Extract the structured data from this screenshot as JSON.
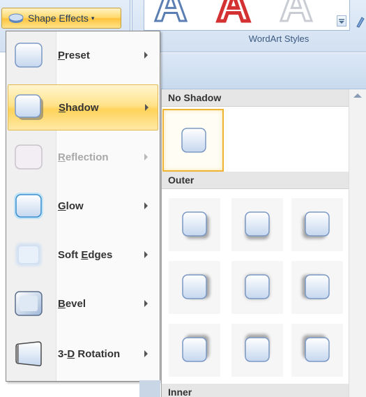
{
  "ribbon": {
    "shape_effects_label": "Shape Effects",
    "wordart_styles_label": "WordArt Styles",
    "wordart_letter": "A",
    "wordart_colors": [
      "#5b7fb3",
      "#d43232",
      "#c9cdd3"
    ]
  },
  "menu": {
    "items": [
      {
        "label": "Preset",
        "accel": "P",
        "rest": "reset",
        "icon": "preset-icon",
        "highlighted": false,
        "disabled": false
      },
      {
        "label": "Shadow",
        "accel": "S",
        "rest": "hadow",
        "icon": "shadow-icon",
        "highlighted": true,
        "disabled": false
      },
      {
        "label": "Reflection",
        "accel": "R",
        "rest": "eflection",
        "icon": "reflection-icon",
        "highlighted": false,
        "disabled": true
      },
      {
        "label": "Glow",
        "accel": "G",
        "rest": "low",
        "icon": "glow-icon",
        "highlighted": false,
        "disabled": false
      },
      {
        "label": "Soft Edges",
        "pre": "Soft ",
        "accel": "E",
        "rest": "dges",
        "icon": "soft-edges-icon",
        "highlighted": false,
        "disabled": false
      },
      {
        "label": "Bevel",
        "accel": "B",
        "rest": "evel",
        "icon": "bevel-icon",
        "highlighted": false,
        "disabled": false
      },
      {
        "label": "3-D Rotation",
        "pre": "3-",
        "accel": "D",
        "rest": " Rotation",
        "icon": "3d-rotation-icon",
        "highlighted": false,
        "disabled": false
      }
    ]
  },
  "submenu": {
    "sections": {
      "no_shadow": "No Shadow",
      "outer": "Outer",
      "inner": "Inner"
    },
    "outer_shadow_directions": [
      "bottom-right",
      "bottom",
      "bottom-left",
      "right",
      "center",
      "left",
      "top-right",
      "top",
      "top-left"
    ]
  },
  "colors": {
    "highlight": "#ffd35b",
    "menu_border": "#868686",
    "swatch_selected_border": "#f0b435"
  }
}
